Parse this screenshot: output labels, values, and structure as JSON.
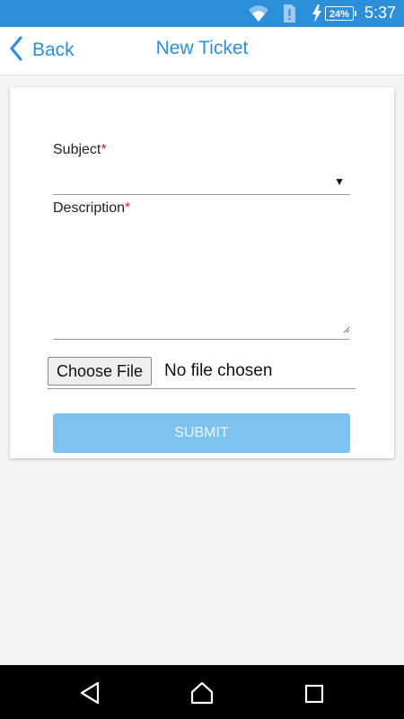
{
  "status_bar": {
    "battery": "24%",
    "time": "5:37",
    "color": "#2c8fd9"
  },
  "app_bar": {
    "back_label": "Back",
    "title": "New Ticket",
    "accent": "#2c8fd9"
  },
  "form": {
    "subject_label": "Subject",
    "description_label": "Description",
    "required_marker": "*",
    "subject_value": "",
    "description_value": "",
    "choose_file_label": "Choose File",
    "file_status": "No file chosen",
    "submit_label": "SUBMIT",
    "submit_color": "#7dc3ef"
  },
  "icons": {
    "back": "chevron-left-icon",
    "wifi": "wifi-icon",
    "sim": "sim-alert-icon",
    "charging": "bolt-icon",
    "nav_back": "triangle-back-icon",
    "nav_home": "home-icon",
    "nav_recents": "square-recents-icon"
  }
}
